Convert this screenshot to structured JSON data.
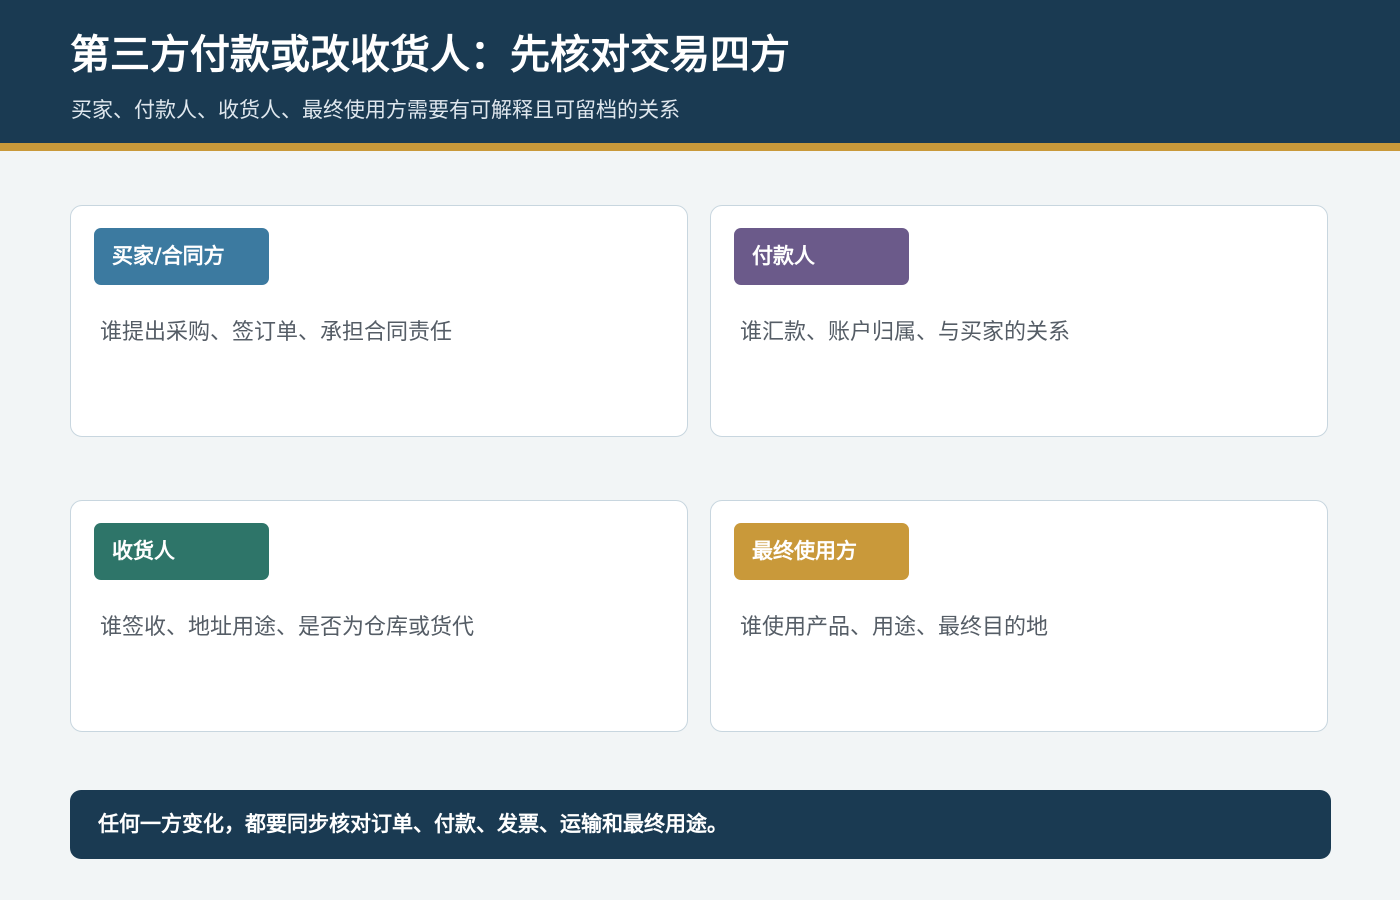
{
  "header": {
    "title": "第三方付款或改收货人：先核对交易四方",
    "subtitle": "买家、付款人、收货人、最终使用方需要有可解释且可留档的关系"
  },
  "cards": [
    {
      "label": "买家/合同方",
      "description": "谁提出采购、签订单、承担合同责任",
      "color": "#3c7aa0"
    },
    {
      "label": "付款人",
      "description": "谁汇款、账户归属、与买家的关系",
      "color": "#6b5a8a"
    },
    {
      "label": "收货人",
      "description": "谁签收、地址用途、是否为仓库或货代",
      "color": "#2e7569"
    },
    {
      "label": "最终使用方",
      "description": "谁使用产品、用途、最终目的地",
      "color": "#c9993a"
    }
  ],
  "footer": {
    "text": "任何一方变化，都要同步核对订单、付款、发票、运输和最终用途。"
  }
}
